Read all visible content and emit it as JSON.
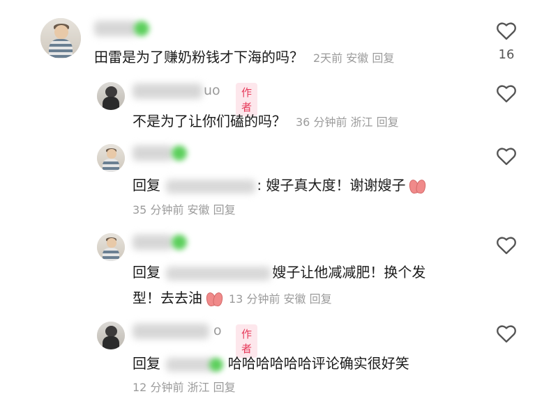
{
  "comments": [
    {
      "text": "田雷是为了赚奶粉钱才下海的吗？",
      "meta": "2天前 安徽 回复",
      "likes": "16"
    },
    {
      "name_tail": "uo",
      "badge": "作者",
      "text": "不是为了让你们磕的吗？",
      "meta": "36 分钟前 浙江 回复"
    },
    {
      "reply_prefix": "回复",
      "text": ": 嫂子真大度！谢谢嫂子",
      "meta": "35 分钟前 安徽 回复"
    },
    {
      "reply_prefix": "回复",
      "text_line1": "嫂子让他减减肥！换个发",
      "text_line2": "型！去去油",
      "meta": "13 分钟前 安徽 回复"
    },
    {
      "name_tail": "o",
      "badge": "作者",
      "reply_prefix": "回复",
      "text": "哈哈哈哈哈哈评论确实很好笑",
      "meta": "12 分钟前 浙江 回复"
    }
  ],
  "icons": [
    "heart-outline-icon",
    "folded-hands-emoji"
  ]
}
